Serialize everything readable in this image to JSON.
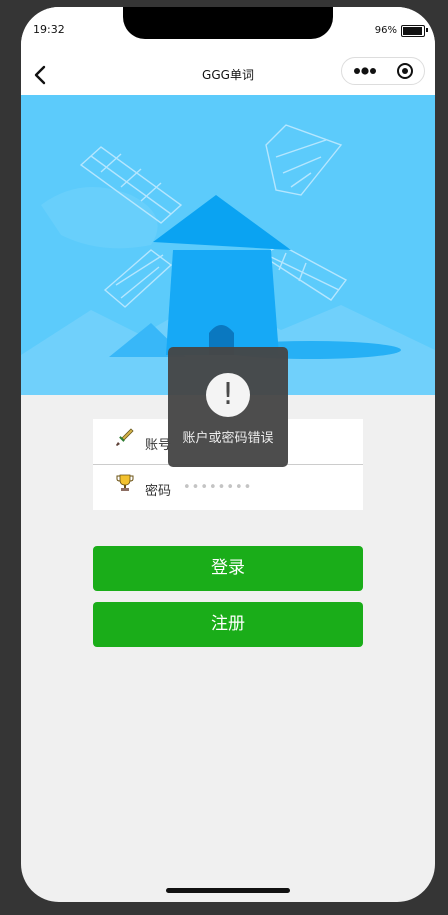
{
  "status_bar": {
    "time": "19:32",
    "battery": "96%",
    "battery_level": 0.96
  },
  "navbar": {
    "title": "GGG单词",
    "back_icon": "chevron-left-icon",
    "more_icon": "more-dots-icon",
    "close_icon": "target-circle-icon"
  },
  "banner": {
    "illustration": "windmill",
    "background_color": "#5ccbfb"
  },
  "form": {
    "account": {
      "icon": "sword-icon",
      "label": "账号",
      "value": ""
    },
    "password": {
      "icon": "trophy-icon",
      "label": "密码",
      "placeholder": "••••••••"
    }
  },
  "buttons": {
    "login": "登录",
    "register": "注册",
    "color": "#1aad19"
  },
  "toast": {
    "icon": "exclamation-icon",
    "glyph": "!",
    "message": "账户或密码错误"
  }
}
